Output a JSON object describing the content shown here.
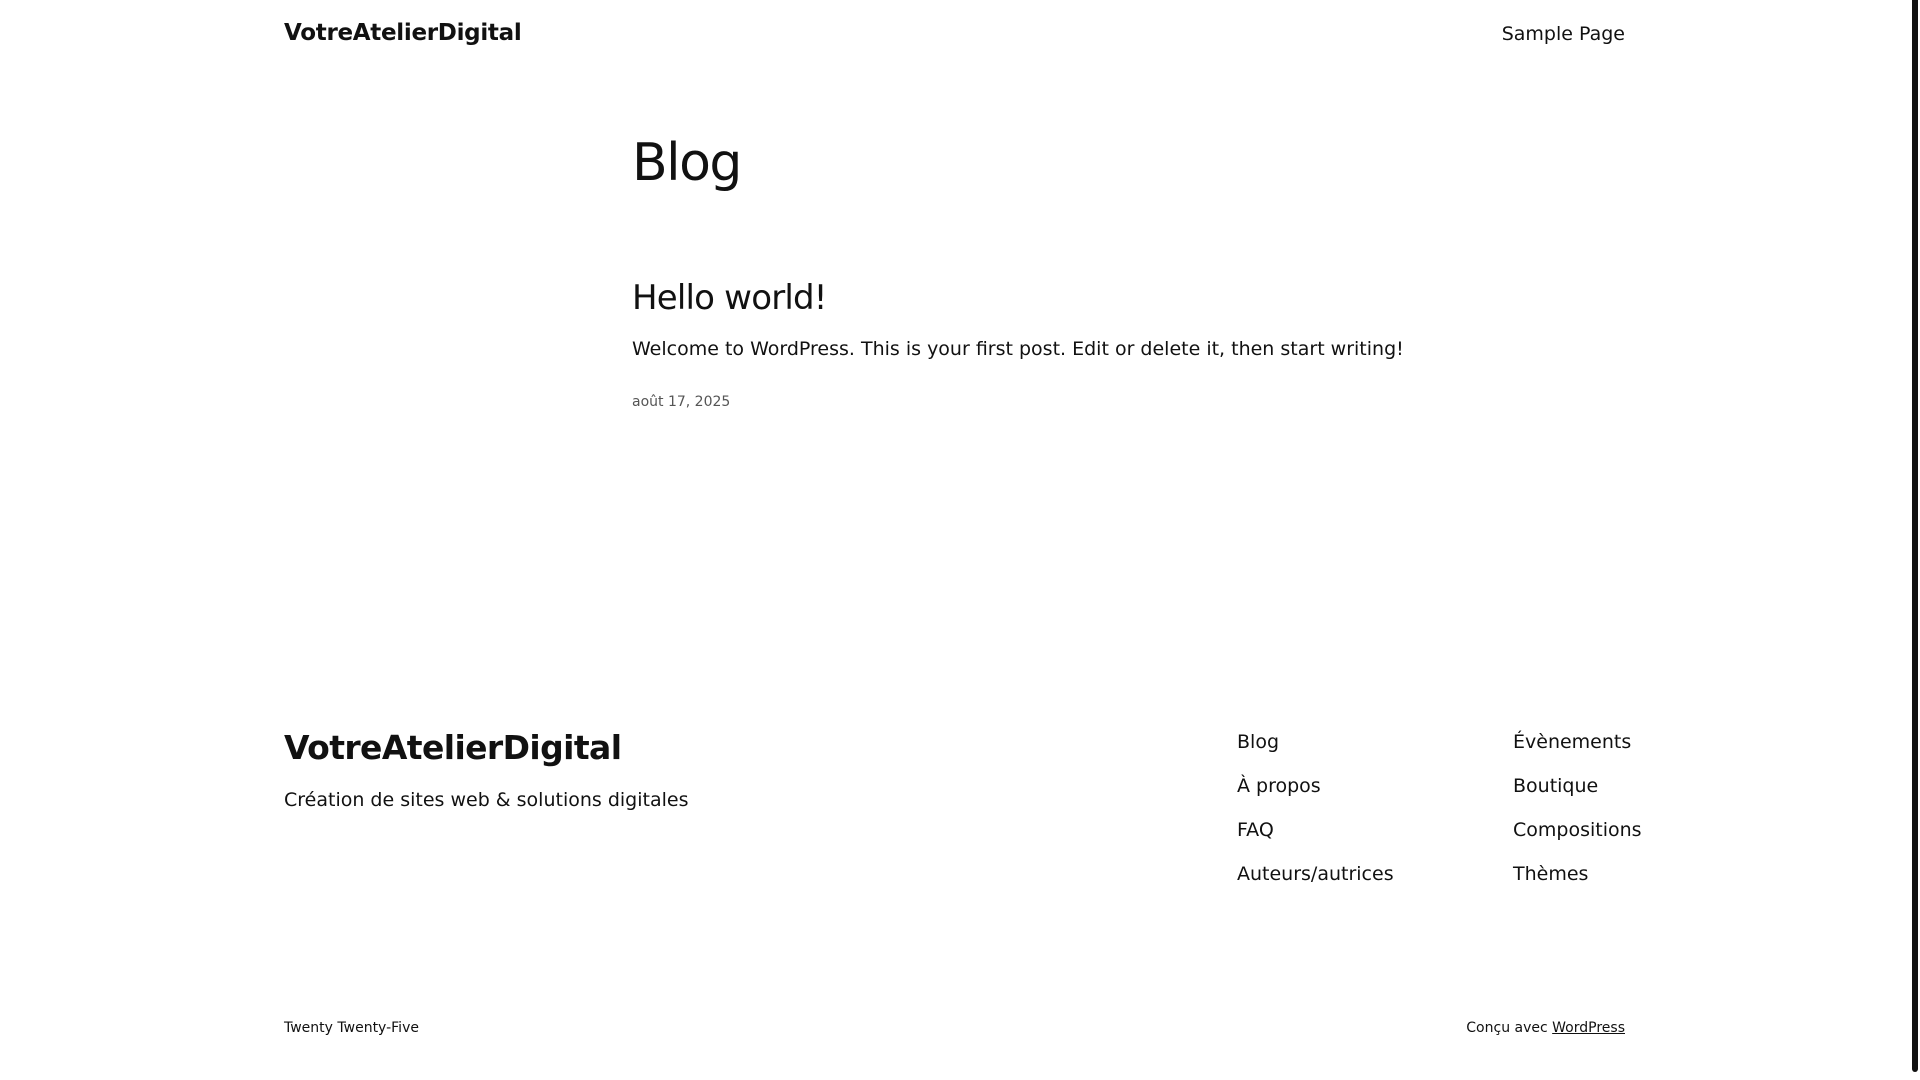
{
  "header": {
    "site_title": "VotreAtelierDigital",
    "nav_link": "Sample Page"
  },
  "main": {
    "page_heading": "Blog",
    "post": {
      "title": "Hello world!",
      "excerpt": "Welcome to WordPress. This is your first post. Edit or delete it, then start writing!",
      "date": "août 17, 2025"
    }
  },
  "footer": {
    "site_title": "VotreAtelierDigital",
    "tagline": "Création de sites web & solutions digitales",
    "nav_col1": [
      "Blog",
      "À propos",
      "FAQ",
      "Auteurs/autrices"
    ],
    "nav_col2": [
      "Évènements",
      "Boutique",
      "Compositions",
      "Thèmes"
    ],
    "theme_credit": "Twenty Twenty-Five",
    "powered_by_prefix": "Conçu avec",
    "powered_by_link": "WordPress"
  }
}
